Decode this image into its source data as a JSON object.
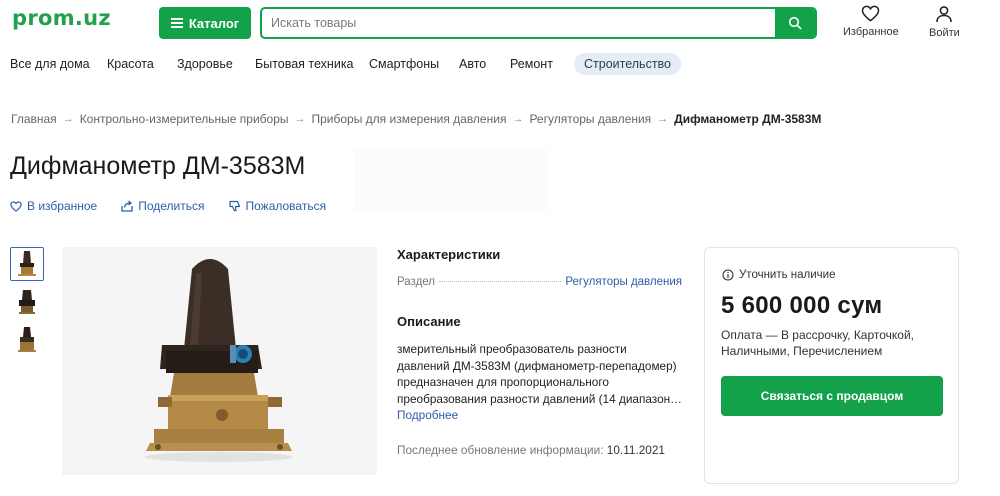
{
  "header": {
    "logo": "prom.uz",
    "catalog_label": "Каталог",
    "search_placeholder": "Искать товары",
    "favorites_label": "Избранное",
    "login_label": "Войти"
  },
  "categories": [
    {
      "label": "Все для дома"
    },
    {
      "label": "Красота"
    },
    {
      "label": "Здоровье"
    },
    {
      "label": "Бытовая техника"
    },
    {
      "label": "Смартфоны"
    },
    {
      "label": "Авто"
    },
    {
      "label": "Ремонт"
    },
    {
      "label": "Строительство",
      "active": true
    }
  ],
  "breadcrumb": [
    "Главная",
    "Контрольно-измерительные приборы",
    "Приборы для измерения давления",
    "Регуляторы давления",
    "Дифманометр ДМ-3583М"
  ],
  "product": {
    "title": "Дифманометр ДМ-3583М",
    "actions": {
      "favorite": "В избранное",
      "share": "Поделиться",
      "report": "Пожаловаться"
    }
  },
  "characteristics": {
    "heading": "Характеристики",
    "rows": [
      {
        "key": "Раздел",
        "value": "Регуляторы давления"
      }
    ]
  },
  "description": {
    "heading": "Описание",
    "text": "змерительный преобразователь разности давлений ДМ-3583М (дифманометр-перепадомер) предназначен для пропорционального преобразования разности давлений (14 диапазон…",
    "more": "Подробнее",
    "updated_label": "Последнее обновление информации:",
    "updated_value": "10.11.2021"
  },
  "offer": {
    "availability": "Уточнить наличие",
    "price": "5 600 000 сум",
    "payment": "Оплата — В рассрочку, Карточкой, Наличными, Перечислением",
    "contact_button": "Связаться с продавцом"
  },
  "colors": {
    "brand_green": "#13a14a",
    "link_blue": "#2e5da8"
  }
}
